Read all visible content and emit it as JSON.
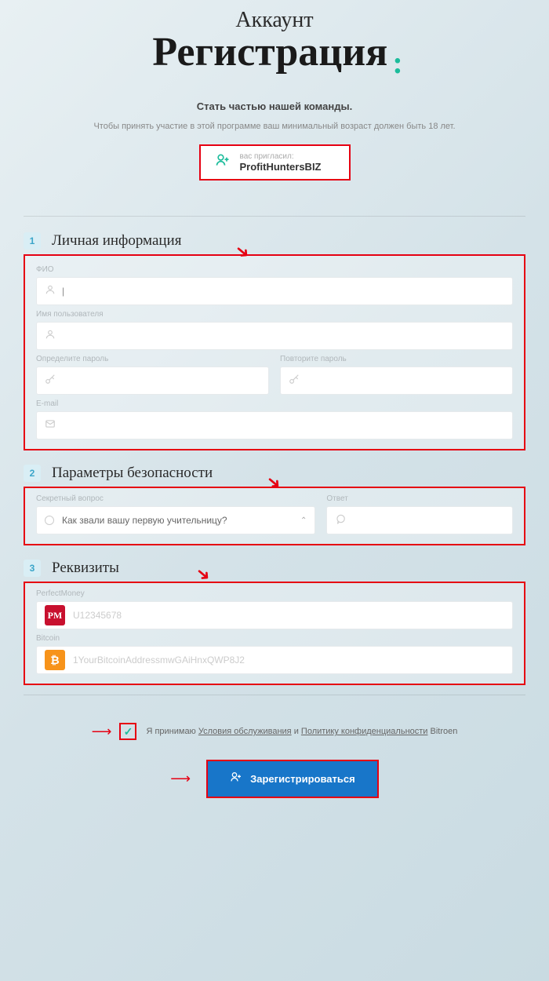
{
  "header": {
    "subtitle": "Аккаунт",
    "title": "Регистрация",
    "tagline": "Стать частью нашей команды.",
    "age_note": "Чтобы принять участие в этой программе ваш минимальный возраст должен быть 18 лет."
  },
  "invite": {
    "label": "вас пригласил:",
    "name": "ProfitHuntersBIZ"
  },
  "sections": {
    "personal": {
      "num": "1",
      "title": "Личная информация"
    },
    "security": {
      "num": "2",
      "title": "Параметры безопасности"
    },
    "payment": {
      "num": "3",
      "title": "Реквизиты"
    }
  },
  "fields": {
    "fio": "ФИО",
    "username": "Имя пользователя",
    "password": "Определите пароль",
    "password2": "Повторите пароль",
    "email": "E-mail",
    "secret_q": "Секретный вопрос",
    "secret_q_value": "Как звали вашу первую учительницу?",
    "secret_a": "Ответ",
    "pm_label": "PerfectMoney",
    "pm_placeholder": "U12345678",
    "btc_label": "Bitcoin",
    "btc_placeholder": "1YourBitcoinAddressmwGAiHnxQWP8J2"
  },
  "terms": {
    "prefix": "Я принимаю ",
    "link1": "Условия обслуживания",
    "mid": " и ",
    "link2": "Политику конфиденциальности",
    "suffix": " Bitroen"
  },
  "register_btn": "Зарегистрироваться"
}
